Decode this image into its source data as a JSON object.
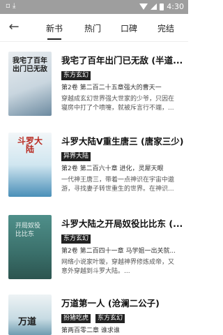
{
  "status_bar": {
    "time": "4:30"
  },
  "nav": {
    "tabs": [
      {
        "label": "新书",
        "active": true
      },
      {
        "label": "热门",
        "active": false
      },
      {
        "label": "口碑",
        "active": false
      },
      {
        "label": "完结",
        "active": false
      }
    ]
  },
  "books": [
    {
      "title": "我宅了百年出门已无敌 (半道...",
      "tag": "东方玄幻",
      "chapter": "第2卷 第二百二十五章强大的曹天一",
      "desc": "穿越成玄幻世界强大世家的少爷，只因在寝房中打了个喷嚏，就被斥言行不端，...",
      "cover_text": "我宅了百年出门已无敌"
    },
    {
      "title": "斗罗大陆V重生唐三 (唐家三少)",
      "tag": "异界大陆",
      "chapter": "第2卷 第二百六十章 进化，灵犀天眼",
      "desc": "一代神王唐三，带着一点神识在宇宙中遨游，寻找妻子转世重生的世界。在神识...",
      "cover_text": "斗罗大陆"
    },
    {
      "title": "斗罗大陆之开局奴役比比东 (...",
      "tag": "东方玄幻",
      "chapter": "第2卷 第二百四十一章 马学姐一出关就...",
      "desc": "网络小说家叶璇，穿越神界修炼成帝，又意外穿越到斗罗大陆。...",
      "cover_text": "开局奴役比比东"
    },
    {
      "title": "万道第一人 (沧澜二公子)",
      "tag": "扮猪吃虎",
      "tag2": "东方玄幻",
      "chapter": "第两百零二章 谁求谁",
      "desc": "",
      "cover_text": "万道"
    }
  ],
  "colors": {
    "tag_bg": "#222222",
    "status_bar": "#9e9e9e"
  }
}
